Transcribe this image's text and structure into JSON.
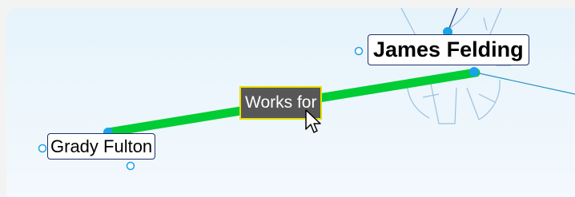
{
  "nodes": {
    "james": {
      "label": "James Felding"
    },
    "grady": {
      "label": "Grady Fulton"
    }
  },
  "relationship": {
    "label": "Works for"
  },
  "colors": {
    "link": "#00cc33",
    "node_handle": "#1aa3e8",
    "node_border": "#1f2f6a",
    "relationship_bg": "#575757",
    "relationship_border": "#e4e000",
    "background_shape": "#9cc0e0",
    "side_link": "#2a8fc4"
  },
  "icons": {
    "pointer": "arrow-cursor-icon"
  }
}
